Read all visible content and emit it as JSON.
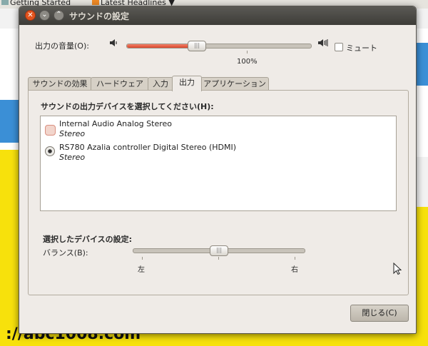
{
  "browser": {
    "bookmark_1": "Getting Started",
    "bookmark_2": "Latest Headlines",
    "chevron": "▼",
    "bottom_text": "://abc1008.com"
  },
  "dialog": {
    "title": "サウンドの設定",
    "output_volume_label": "出力の音量(O):",
    "volume_percent": "100%",
    "volume_level": 0.38,
    "mute_label": "ミュート",
    "mute_checked": false,
    "tabs": [
      {
        "label": "サウンドの効果",
        "active": false
      },
      {
        "label": "ハードウェア",
        "active": false
      },
      {
        "label": "入力",
        "active": false
      },
      {
        "label": "出力",
        "active": true
      },
      {
        "label": "アプリケーション",
        "active": false
      }
    ],
    "device_section_label": "サウンドの出力デバイスを選択してください(H):",
    "devices": [
      {
        "name": "Internal Audio Analog Stereo",
        "profile": "Stereo",
        "selected": false
      },
      {
        "name": "RS780 Azalia controller Digital Stereo (HDMI)",
        "profile": "Stereo",
        "selected": true
      }
    ],
    "settings_section_label": "選択したデバイスの設定:",
    "balance_label": "バランス(B):",
    "balance_left": "左",
    "balance_right": "右",
    "balance_level": 0.5,
    "close_button": "閉じる(C)"
  },
  "icons": {
    "speaker_low": "speaker-low-icon",
    "speaker_high": "speaker-high-icon",
    "rss": "rss-icon",
    "cursor": "mouse-pointer-icon"
  }
}
